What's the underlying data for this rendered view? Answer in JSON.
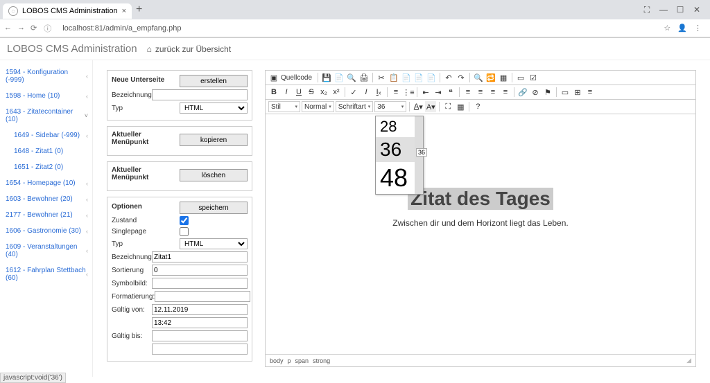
{
  "browser": {
    "tab_title": "LOBOS CMS Administration",
    "url": "localhost:81/admin/a_empfang.php"
  },
  "app": {
    "title": "LOBOS CMS Administration",
    "back_label": "zurück zur Übersicht"
  },
  "sidebar": {
    "items": [
      {
        "label": "1594 - Konfiguration (-999)"
      },
      {
        "label": "1598 - Home (10)"
      },
      {
        "label": "1643 - Zitatecontainer (10)"
      },
      {
        "label": "1649 - Sidebar (-999)"
      },
      {
        "label": "1648 - Zitat1 (0)"
      },
      {
        "label": "1651 - Zitat2 (0)"
      },
      {
        "label": "1654 - Homepage (10)"
      },
      {
        "label": "1603 - Bewohner (20)"
      },
      {
        "label": "2177 - Bewohner (21)"
      },
      {
        "label": "1606 - Gastronomie (30)"
      },
      {
        "label": "1609 - Veranstaltungen (40)"
      },
      {
        "label": "1612 - Fahrplan Stettbach (60)"
      }
    ]
  },
  "form": {
    "new_page": {
      "title": "Neue Unterseite",
      "bezeichnung_label": "Bezeichnung",
      "typ_label": "Typ",
      "typ_value": "HTML",
      "button": "erstellen"
    },
    "copy": {
      "title": "Aktueller Menüpunkt",
      "button": "kopieren"
    },
    "delete": {
      "title": "Aktueller Menüpunkt",
      "button": "löschen"
    },
    "options": {
      "title": "Optionen",
      "button": "speichern",
      "zustand": "Zustand",
      "singlepage": "Singlepage",
      "typ_label": "Typ",
      "typ_value": "HTML",
      "bezeichnung_label": "Bezeichnung",
      "bezeichnung_value": "Zitat1",
      "sortierung_label": "Sortierung",
      "sortierung_value": "0",
      "symbolbild": "Symbolbild:",
      "formatierung": "Formatierung:",
      "gueltig_von": "Gültig von:",
      "gueltig_von_date": "12.11.2019",
      "gueltig_von_time": "13:42",
      "gueltig_bis": "Gültig bis:"
    }
  },
  "editor": {
    "quellcode": "Quellcode",
    "combos": {
      "stil": "Stil",
      "normal": "Normal",
      "schriftart": "Schriftart",
      "size": "36"
    },
    "size_options": {
      "o28": "28",
      "o36": "36",
      "o48": "48",
      "tooltip": "36"
    },
    "heading": "Zitat des Tages",
    "subtitle": "Zwischen dir und dem Horizont liegt das Leben.",
    "footer_tags": {
      "body": "body",
      "p": "p",
      "span": "span",
      "strong": "strong"
    }
  },
  "statusbar": "javascript:void('36')"
}
